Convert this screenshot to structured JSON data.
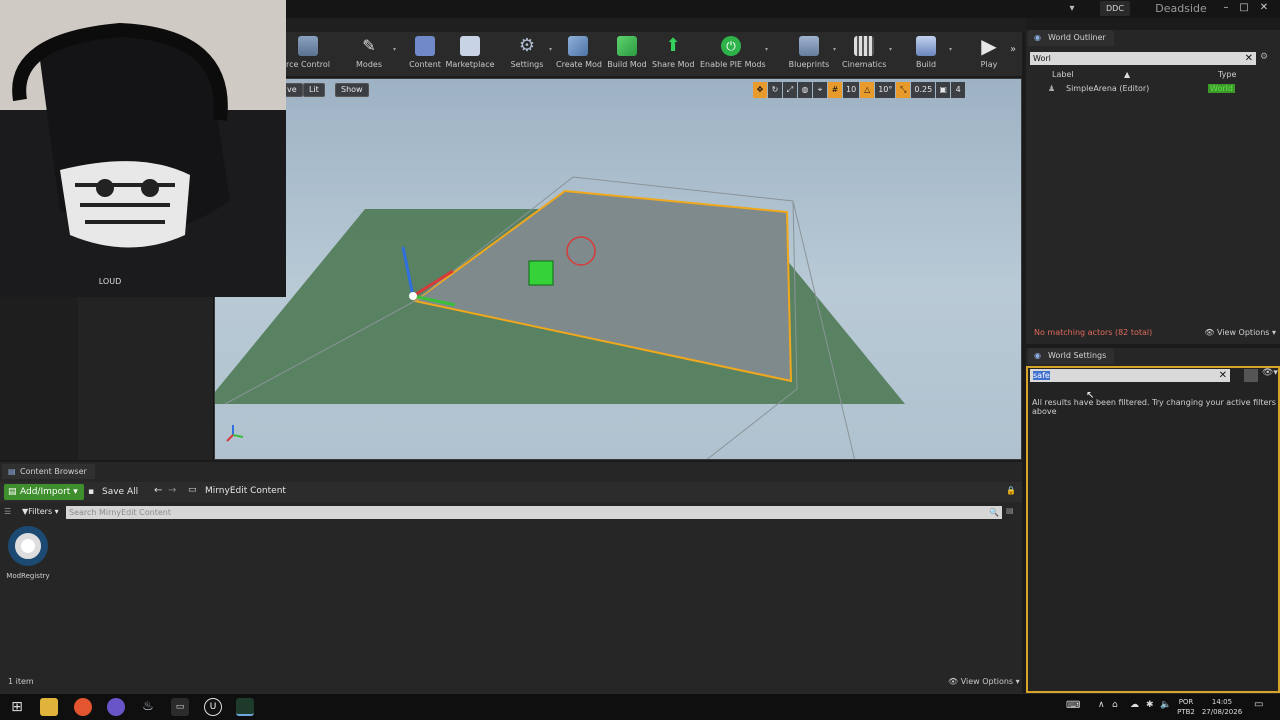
{
  "titlebar": {
    "ddc": "DDC",
    "project": "Deadside"
  },
  "toolbar": {
    "items": [
      {
        "label": "rce Control",
        "icon": "source-control-icon"
      },
      {
        "label": "Modes",
        "icon": "modes-icon"
      },
      {
        "label": "Content",
        "icon": "content-icon"
      },
      {
        "label": "Marketplace",
        "icon": "marketplace-icon"
      },
      {
        "label": "Settings",
        "icon": "settings-icon"
      },
      {
        "label": "Create Mod",
        "icon": "create-mod-icon"
      },
      {
        "label": "Build Mod",
        "icon": "build-mod-icon"
      },
      {
        "label": "Share Mod",
        "icon": "share-mod-icon"
      },
      {
        "label": "Enable PIE Mods",
        "icon": "power-icon"
      },
      {
        "label": "Blueprints",
        "icon": "blueprints-icon"
      },
      {
        "label": "Cinematics",
        "icon": "cinematics-icon"
      },
      {
        "label": "Build",
        "icon": "build-icon"
      },
      {
        "label": "Play",
        "icon": "play-icon"
      }
    ]
  },
  "viewport": {
    "left_buttons": {
      "perspective": "ve",
      "lit": "Lit",
      "show": "Show"
    },
    "grid_snap": "10",
    "rotation_snap": "10°",
    "scale_snap": "0.25",
    "camera_speed": "4"
  },
  "webcam": {
    "brand": "LOUD"
  },
  "outliner": {
    "tab": "World Outliner",
    "search_value": "Worl",
    "col_label": "Label",
    "col_type": "Type",
    "row_label": "SimpleArena (Editor)",
    "row_type": "World",
    "status": "No matching actors (82 total)",
    "view_options": "View Options"
  },
  "world_settings": {
    "tab": "World Settings",
    "search_value": "safe",
    "message": "All results have been filtered. Try changing your active filters above"
  },
  "content_browser": {
    "tab": "Content Browser",
    "add_import": "Add/Import",
    "save_all": "Save All",
    "path": "MirnyEdit Content",
    "filters": "Filters",
    "search_placeholder": "Search MirnyEdit Content",
    "asset_label": "ModRegistry",
    "item_count": "1 item",
    "view_options": "View Options"
  },
  "taskbar": {
    "lang": "POR",
    "layout": "PTB2",
    "time": "14:05",
    "date": "27/08/2026"
  },
  "colors": {
    "accent_orange": "#e89b2b",
    "add_green": "#3f8f2e",
    "panel": "#262626"
  }
}
